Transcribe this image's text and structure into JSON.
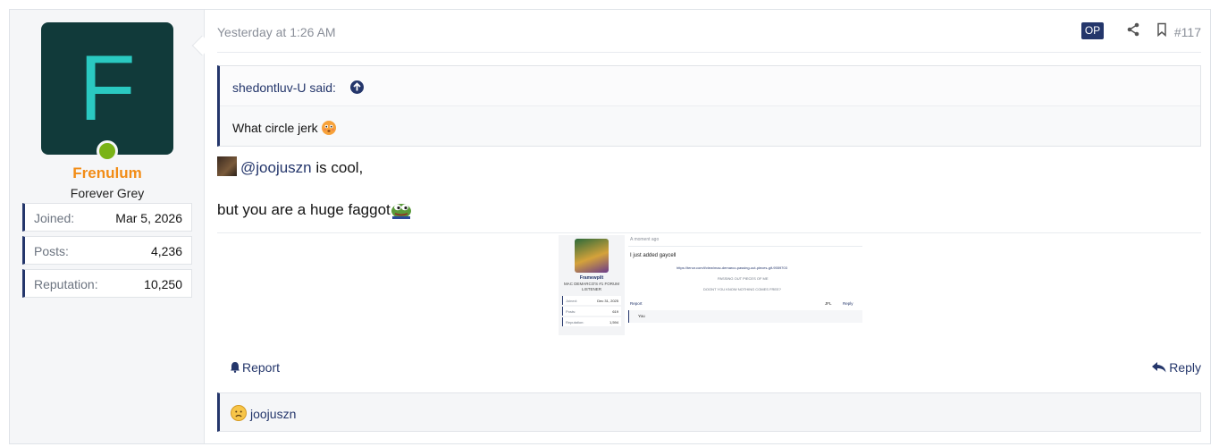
{
  "user": {
    "avatar_letter": "F",
    "avatar_bg": "#113a3a",
    "avatar_fg": "#2ac9c1",
    "online": true,
    "name": "Frenulum",
    "name_color": "#f28c16",
    "title": "Forever Grey",
    "stats": [
      {
        "label": "Joined:",
        "value": "Mar 5, 2026"
      },
      {
        "label": "Posts:",
        "value": "4,236"
      },
      {
        "label": "Reputation:",
        "value": "10,250"
      }
    ]
  },
  "post": {
    "date": "Yesterday at 1:26 AM",
    "op_badge": "OP",
    "share_icon": "share-icon",
    "bookmark_icon": "bookmark-icon",
    "number": "#117",
    "quote": {
      "author": "shedontluv-U said:",
      "up_icon": "arrow-up-circle-icon",
      "text": "What circle jerk",
      "emoji": "flushed-emoji"
    },
    "line1_mention": "@joojuszn",
    "line1_rest": " is cool,",
    "line2_text": "but you are a huge faggot",
    "line2_emoji": "pepe-emoji",
    "attachment": {
      "user_name": "Framewpilt",
      "user_title": "MAC DEMARCO'S #1 FORUM LISTENER",
      "stats": [
        {
          "label": "Joined:",
          "value": "Dec 31, 2025"
        },
        {
          "label": "Posts:",
          "value": "619"
        },
        {
          "label": "Reputation:",
          "value": "1,594"
        }
      ],
      "date": "A moment ago",
      "text1": "I just added gaycell",
      "link": "https://tenor.com/t/view/mac-demarco-passing-out-pieces-gif-9559703",
      "text2": "PASSING OUT PIECES OF ME",
      "text3": "DOONT YOU KNOW NOTHING COMES FREE?",
      "report": "Report",
      "react": "JFL",
      "reply": "Reply",
      "reaction": "You"
    },
    "report_label": "Report",
    "reply_label": "Reply",
    "reaction_user": "joojuszn",
    "reaction_icon": "sad-face-emoji"
  },
  "colors": {
    "accent": "#24366b",
    "muted": "#8a8f99",
    "online": "#7ab317"
  }
}
